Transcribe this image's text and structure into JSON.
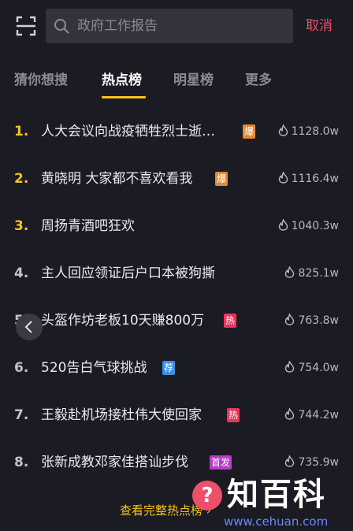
{
  "search": {
    "placeholder": "政府工作报告",
    "cancel_label": "取消"
  },
  "tabs": [
    {
      "label": "猜你想搜",
      "active": false
    },
    {
      "label": "热点榜",
      "active": true
    },
    {
      "label": "明星榜",
      "active": false
    },
    {
      "label": "更多",
      "active": false
    }
  ],
  "items": [
    {
      "rank": "1.",
      "title": "人大会议向战疫牺牲烈士逝…",
      "badge": "爆",
      "badge_color": "#e8892b",
      "heat": "1128.0w"
    },
    {
      "rank": "2.",
      "title": "黄晓明 大家都不喜欢看我",
      "badge": "爆",
      "badge_color": "#e8892b",
      "heat": "1116.4w"
    },
    {
      "rank": "3.",
      "title": "周扬青酒吧狂欢",
      "badge": "",
      "badge_color": "",
      "heat": "1040.3w"
    },
    {
      "rank": "4.",
      "title": "主人回应领证后户口本被狗撕",
      "badge": "",
      "badge_color": "",
      "heat": "825.1w"
    },
    {
      "rank": "5.",
      "title": "头盔作坊老板10天赚800万",
      "badge": "热",
      "badge_color": "#e8345c",
      "heat": "763.8w"
    },
    {
      "rank": "6.",
      "title": "520告白气球挑战",
      "badge": "荐",
      "badge_color": "#3a8ee6",
      "heat": "754.0w"
    },
    {
      "rank": "7.",
      "title": "王毅赴机场接杜伟大使回家",
      "badge": "热",
      "badge_color": "#e8345c",
      "heat": "744.2w"
    },
    {
      "rank": "8.",
      "title": "张新成教邓家佳搭讪步伐",
      "badge": "首发",
      "badge_color": "#b43cc8",
      "heat": "735.9w"
    }
  ],
  "view_all_label": "查看完整热点榜 ›",
  "watermark": {
    "mark": "?",
    "text": "知百科",
    "url": "www.cehuan.com"
  },
  "colors": {
    "accent": "#f5c518",
    "cancel": "#ee4f6b",
    "background": "#1b1b23"
  }
}
